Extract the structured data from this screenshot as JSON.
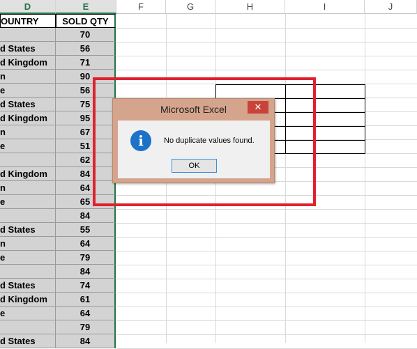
{
  "columns": [
    "D",
    "E",
    "F",
    "G",
    "H",
    "I",
    "J"
  ],
  "table": {
    "headers": {
      "country": "OUNTRY",
      "sold_qty": "SOLD QTY"
    },
    "rows": [
      {
        "country": "",
        "qty": "70"
      },
      {
        "country": "d States",
        "qty": "56"
      },
      {
        "country": "d Kingdom",
        "qty": "71"
      },
      {
        "country": "n",
        "qty": "90"
      },
      {
        "country": "e",
        "qty": "56"
      },
      {
        "country": "d States",
        "qty": "75"
      },
      {
        "country": "d Kingdom",
        "qty": "95"
      },
      {
        "country": "n",
        "qty": "67"
      },
      {
        "country": "e",
        "qty": "51"
      },
      {
        "country": "",
        "qty": "62"
      },
      {
        "country": "d Kingdom",
        "qty": "84"
      },
      {
        "country": "n",
        "qty": "64"
      },
      {
        "country": "e",
        "qty": "65"
      },
      {
        "country": "",
        "qty": "84"
      },
      {
        "country": "d States",
        "qty": "55"
      },
      {
        "country": "n",
        "qty": "64"
      },
      {
        "country": "e",
        "qty": "79"
      },
      {
        "country": "",
        "qty": "84"
      },
      {
        "country": "d States",
        "qty": "74"
      },
      {
        "country": "d Kingdom",
        "qty": "61"
      },
      {
        "country": "e",
        "qty": "64"
      },
      {
        "country": "",
        "qty": "79"
      },
      {
        "country": "d States",
        "qty": "84"
      }
    ]
  },
  "dialog": {
    "title": "Microsoft Excel",
    "close_label": "✕",
    "icon": "info-icon",
    "icon_glyph": "i",
    "message": "No duplicate values found.",
    "ok_label": "OK"
  },
  "colors": {
    "highlight_box": "#e0202e",
    "selection": "#217346",
    "dialog_frame": "#d5a48c"
  }
}
